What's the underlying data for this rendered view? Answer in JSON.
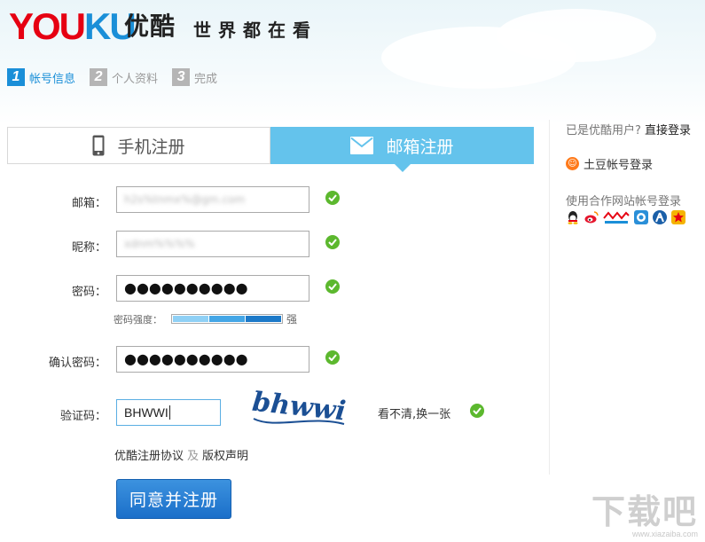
{
  "brand": {
    "logo_you": "YOU",
    "logo_ku": "KU",
    "logo_cn": "优酷",
    "slogan": "世界都在看"
  },
  "steps": [
    {
      "num": "1",
      "label": "帐号信息",
      "active": true
    },
    {
      "num": "2",
      "label": "个人资料",
      "active": false
    },
    {
      "num": "3",
      "label": "完成",
      "active": false
    }
  ],
  "tabs": {
    "phone_label": "手机注册",
    "email_label": "邮箱注册",
    "active": "email"
  },
  "form": {
    "email": {
      "label": "邮箱：",
      "value": "h2s%tnmx%@gm.com"
    },
    "nickname": {
      "label": "昵称：",
      "value": "xdnm%%%%"
    },
    "password": {
      "label": "密码：",
      "value": "●●●●●●●●●●"
    },
    "strength": {
      "label": "密码强度：",
      "text": "强",
      "level": 1.0
    },
    "confirm_password": {
      "label": "确认密码：",
      "value": "●●●●●●●●●●"
    },
    "captcha": {
      "label": "验证码：",
      "value": "BHWWI",
      "image_text": "bhwwi",
      "refresh_label": "看不清,换一张"
    },
    "agreement": {
      "terms": "优酷注册协议",
      "and": "及",
      "copyright": "版权声明"
    },
    "submit_label": "同意并注册"
  },
  "sidebar": {
    "existing_user": "已是优酷用户?",
    "login_link": "直接登录",
    "tudou_login": "土豆帐号登录",
    "partner_text": "使用合作网站帐号登录",
    "partner_icons": [
      "qq-icon",
      "weibo-icon",
      "alipay-icon",
      "paipai-icon",
      "renren-icon",
      "kaixin-icon"
    ]
  },
  "watermark": {
    "big": "下载吧",
    "small": "www.xiazaiba.com"
  },
  "colors": {
    "accent": "#64c3ec",
    "brand_blue": "#1a8fd8",
    "brand_red": "#e60012",
    "valid_green": "#5cb82e",
    "button": "#1b6fc9"
  }
}
